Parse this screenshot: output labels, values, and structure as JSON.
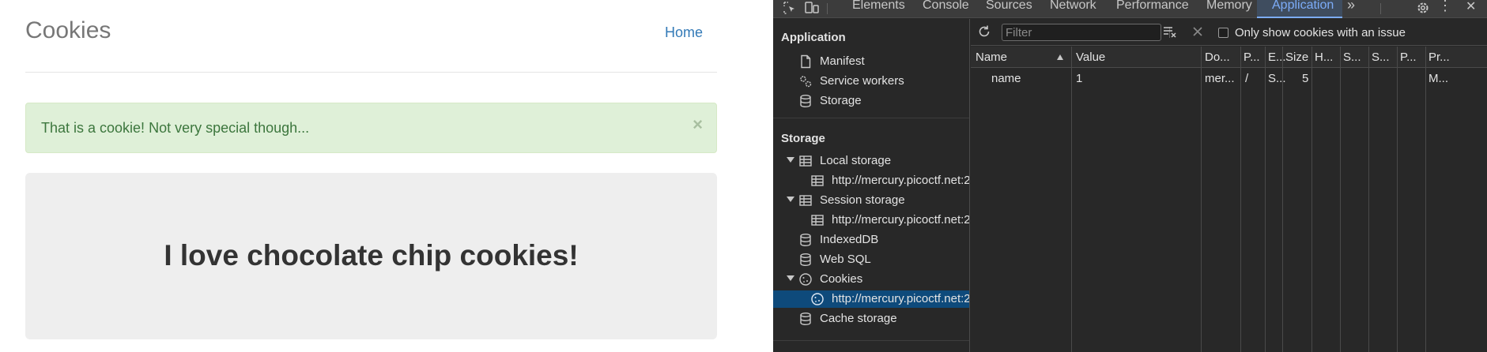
{
  "site": {
    "title": "Cookies",
    "nav_home": "Home",
    "alert_text": "That is a cookie! Not very special though...",
    "alert_close": "×",
    "jumbotron_text": "I love chocolate chip cookies!"
  },
  "devtools": {
    "tabs": [
      "Elements",
      "Console",
      "Sources",
      "Network",
      "Performance",
      "Memory",
      "Application"
    ],
    "more_tabs": "»",
    "close": "✕",
    "more_menu": "⋮",
    "sidebar": {
      "application_header": "Application",
      "application_items": [
        "Manifest",
        "Service workers",
        "Storage"
      ],
      "storage_header": "Storage",
      "local_storage": "Local storage",
      "local_storage_child": "http://mercury.picoctf.net:2",
      "session_storage": "Session storage",
      "session_storage_child": "http://mercury.picoctf.net:2",
      "indexeddb": "IndexedDB",
      "websql": "Web SQL",
      "cookies": "Cookies",
      "cookies_child": "http://mercury.picoctf.net:2",
      "cache_storage": "Cache storage"
    },
    "filter": {
      "placeholder": "Filter",
      "issue_label": "Only show cookies with an issue"
    },
    "grid": {
      "headers": [
        "Name",
        "Value",
        "Do...",
        "P...",
        "E...",
        "Size",
        "H...",
        "S...",
        "S...",
        "P...",
        "Pr..."
      ],
      "rows": [
        [
          "name",
          "1",
          "mer...",
          "/",
          "S...",
          "5",
          "",
          "",
          "",
          "",
          "M..."
        ]
      ]
    }
  }
}
